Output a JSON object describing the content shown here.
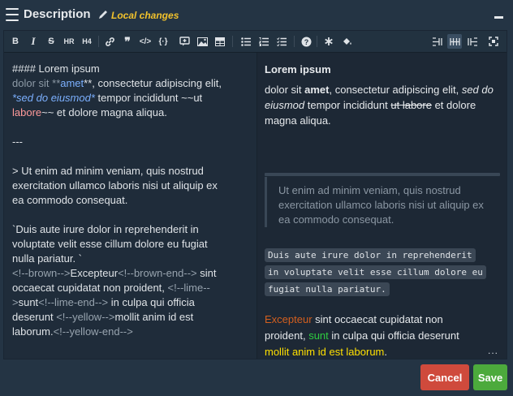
{
  "header": {
    "title": "Description",
    "status": "Local changes"
  },
  "toolbar": {
    "bold": "B",
    "italic": "I",
    "strike": "S",
    "hr": "HR",
    "h4": "H4"
  },
  "source": {
    "line1": "#### Lorem ipsum",
    "line2a": " dolor sit **",
    "line2b": "amet",
    "line2c": "**, consectetur adipiscing elit,",
    "line3a": "*sed do eiusmod*",
    "line3b": " tempor incididunt ~~",
    "line3c": "ut",
    "line4a": "labore",
    "line4b": "~~ et dolore magna aliqua.",
    "hrline": "---",
    "quote1": "> Ut enim ad minim veniam, quis nostrud",
    "quote2": "exercitation ullamco laboris nisi ut aliquip ex",
    "quote3": "ea commodo consequat.",
    "code1": "`Duis aute irure dolor in reprehenderit in",
    "code2": "voluptate velit esse cillum dolore eu fugiat",
    "code3": "nulla pariatur. `",
    "c1a": "<!--brown-->",
    "c1b": "Excepteur",
    "c1c": "<!--brown-end-->",
    "c1d": " sint",
    "c2a": "occaecat cupidatat non proident, ",
    "c2b": "<!--lime--",
    "c3a": ">",
    "c3b": "sunt",
    "c3c": "<!--lime-end-->",
    "c3d": " in culpa qui officia",
    "c4a": "deserunt ",
    "c4b": "<!--yellow-->",
    "c4c": "mollit anim id est",
    "c5a": "laborum.",
    "c5b": "<!--yellow-end-->"
  },
  "preview": {
    "heading": "Lorem ipsum",
    "p1a": "dolor sit ",
    "p1b": "amet",
    "p1c": ", consectetur adipiscing elit, ",
    "p1d": "sed do eiusmod",
    "p1e": " tempor incididunt ",
    "p1f": "ut labore",
    "p1g": " et dolore magna aliqua.",
    "quote": "Ut enim ad minim veniam, quis nostrud exercitation ullamco laboris nisi ut aliquip ex ea commodo consequat.",
    "code1": "Duis aute irure dolor in reprehenderit",
    "code2": "in voluptate velit esse cillum dolore eu",
    "code3": "fugiat nulla pariatur.",
    "c1": "Excepteur",
    "c1b": " sint occaecat cupidatat non",
    "c2a": "proident, ",
    "c2b": "sunt",
    "c2c": " in culpa qui officia deserunt",
    "c3": "mollit anim id est laborum",
    "c3b": "."
  },
  "footer": {
    "ellipsis": "...",
    "cancel_label": "Cancel",
    "save_label": "Save"
  },
  "colors": {
    "brown": "#d35f1f",
    "lime": "#2ecc40",
    "yellow": "#ffe000",
    "cancel": "#cf4a3c",
    "save": "#4caa3c",
    "status": "#f2c22c"
  }
}
